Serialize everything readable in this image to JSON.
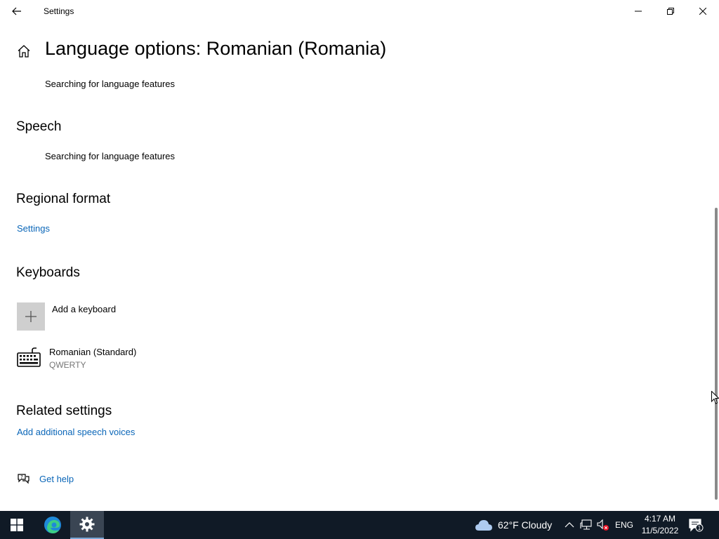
{
  "window": {
    "title": "Settings"
  },
  "page": {
    "title": "Language options: Romanian (Romania)",
    "language_features_status": "Searching for language features"
  },
  "speech": {
    "heading": "Speech",
    "status": "Searching for language features"
  },
  "regional_format": {
    "heading": "Regional format",
    "link": "Settings"
  },
  "keyboards": {
    "heading": "Keyboards",
    "add_label": "Add a keyboard",
    "items": [
      {
        "name": "Romanian (Standard)",
        "layout": "QWERTY"
      }
    ]
  },
  "related_settings": {
    "heading": "Related settings",
    "link": "Add additional speech voices"
  },
  "help": {
    "label": "Get help"
  },
  "taskbar": {
    "weather_text": "62°F  Cloudy",
    "language": "ENG",
    "time": "4:17 AM",
    "date": "11/5/2022",
    "notification_count": "1"
  },
  "colors": {
    "link": "#0a66b8",
    "taskbar": "#101a26",
    "tile": "#cfcfcf"
  }
}
